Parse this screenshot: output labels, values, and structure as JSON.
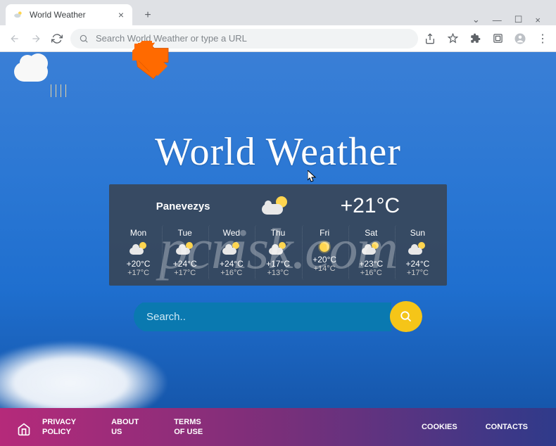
{
  "browser": {
    "tab_title": "World Weather",
    "omnibox_placeholder": "Search World Weather or type a URL"
  },
  "page": {
    "brand": "World Weather",
    "search_placeholder": "Search.."
  },
  "weather": {
    "city": "Panevezys",
    "current_temp": "+21°C",
    "forecast": [
      {
        "day": "Mon",
        "icon": "sun-cloud",
        "hi": "+20°C",
        "lo": "+17°C"
      },
      {
        "day": "Tue",
        "icon": "sun-cloud",
        "hi": "+24°C",
        "lo": "+17°C"
      },
      {
        "day": "Wed",
        "icon": "sun-cloud",
        "hi": "+24°C",
        "lo": "+16°C"
      },
      {
        "day": "Thu",
        "icon": "sun-cloud",
        "hi": "+17°C",
        "lo": "+13°C"
      },
      {
        "day": "Fri",
        "icon": "sun",
        "hi": "+20°C",
        "lo": "+14°C"
      },
      {
        "day": "Sat",
        "icon": "sun-cloud",
        "hi": "+23°C",
        "lo": "+16°C"
      },
      {
        "day": "Sun",
        "icon": "sun-cloud",
        "hi": "+24°C",
        "lo": "+17°C"
      }
    ]
  },
  "footer": {
    "links_left": [
      {
        "line1": "PRIVACY",
        "line2": "POLICY"
      },
      {
        "line1": "ABOUT",
        "line2": "US"
      },
      {
        "line1": "TERMS",
        "line2": "OF USE"
      }
    ],
    "links_right": [
      {
        "label": "COOKIES"
      },
      {
        "label": "CONTACTS"
      }
    ]
  },
  "watermark": "pcrisk.com"
}
